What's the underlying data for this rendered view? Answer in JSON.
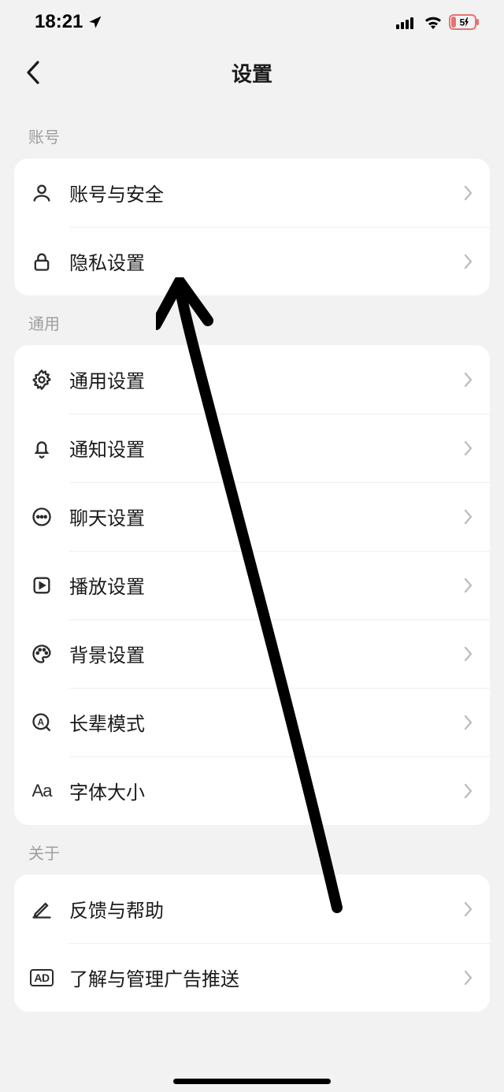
{
  "statusBar": {
    "time": "18:21",
    "batteryText": "5"
  },
  "header": {
    "title": "设置"
  },
  "sections": {
    "account": {
      "label": "账号",
      "items": [
        {
          "label": "账号与安全"
        },
        {
          "label": "隐私设置"
        }
      ]
    },
    "general": {
      "label": "通用",
      "items": [
        {
          "label": "通用设置"
        },
        {
          "label": "通知设置"
        },
        {
          "label": "聊天设置"
        },
        {
          "label": "播放设置"
        },
        {
          "label": "背景设置"
        },
        {
          "label": "长辈模式"
        },
        {
          "label": "字体大小"
        }
      ]
    },
    "about": {
      "label": "关于",
      "items": [
        {
          "label": "反馈与帮助"
        },
        {
          "label": "了解与管理广告推送"
        }
      ]
    }
  }
}
